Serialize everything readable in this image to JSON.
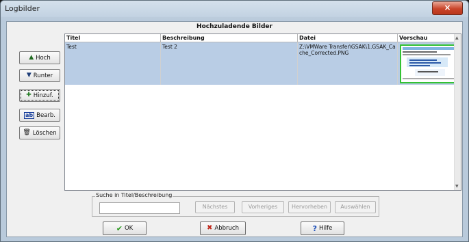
{
  "window": {
    "title": "Logbilder",
    "close_icon": "×"
  },
  "dialog": {
    "heading": "Hochzuladende Bilder"
  },
  "side_buttons": [
    {
      "label": "Hoch",
      "icon": "up-arrow-icon",
      "glyph": "▲"
    },
    {
      "label": "Runter",
      "icon": "down-arrow-icon",
      "glyph": "▼"
    },
    {
      "label": "Hinzuf.",
      "icon": "plus-icon",
      "glyph": "✚"
    },
    {
      "label": "Bearb.",
      "icon": "edit-icon",
      "glyph": "ab"
    },
    {
      "label": "Löschen",
      "icon": "trash-icon",
      "glyph": "🗑"
    }
  ],
  "table": {
    "columns": [
      "Titel",
      "Beschreibung",
      "Datei",
      "Vorschau"
    ],
    "rows": [
      {
        "titel": "Test",
        "beschreibung": "Test 2",
        "datei": "Z:\\VMWare Transfer\\GSAK\\1.GSAK_Cache_Corrected.PNG"
      }
    ]
  },
  "search": {
    "label": "Suche in Titel/Beschreibung",
    "value": "",
    "buttons": [
      "Nächstes",
      "Vorheriges",
      "Hervorheben",
      "Auswählen"
    ]
  },
  "bottom_buttons": [
    {
      "label": "OK",
      "icon": "checkmark-icon",
      "glyph": "✔",
      "color": "#2a9a1e"
    },
    {
      "label": "Abbruch",
      "icon": "x-icon",
      "glyph": "✖",
      "color": "#c0271b"
    },
    {
      "label": "Hilfe",
      "icon": "question-icon",
      "glyph": "?",
      "color": "#1d4fb8"
    }
  ]
}
